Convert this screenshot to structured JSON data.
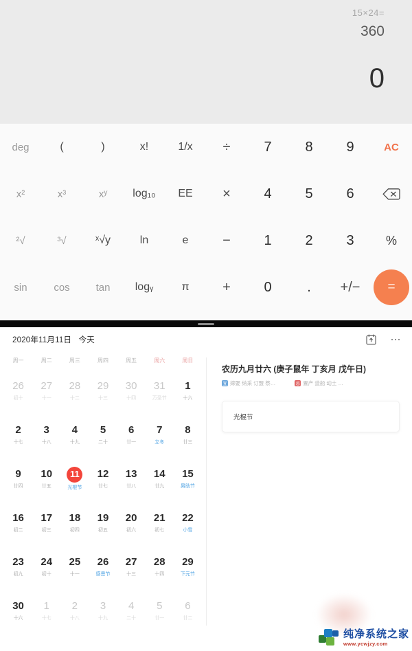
{
  "calculator": {
    "display": {
      "expression": "15×24=",
      "previous_result": "360",
      "current": "0"
    },
    "rows": [
      [
        {
          "label": "deg",
          "type": "fn",
          "name": "deg"
        },
        {
          "label": "(",
          "type": "fn-dark",
          "name": "open-paren"
        },
        {
          "label": ")",
          "type": "fn-dark",
          "name": "close-paren"
        },
        {
          "label": "x!",
          "type": "fn-dark",
          "name": "factorial"
        },
        {
          "label": "1/x",
          "type": "fn-dark",
          "name": "reciprocal"
        },
        {
          "label": "÷",
          "type": "op",
          "name": "divide"
        },
        {
          "label": "7",
          "type": "num",
          "name": "seven"
        },
        {
          "label": "8",
          "type": "num",
          "name": "eight"
        },
        {
          "label": "9",
          "type": "num",
          "name": "nine"
        },
        {
          "label": "AC",
          "type": "ac",
          "name": "all-clear"
        }
      ],
      [
        {
          "label": "x²",
          "type": "fn",
          "name": "square"
        },
        {
          "label": "x³",
          "type": "fn",
          "name": "cube"
        },
        {
          "label": "xʸ",
          "type": "fn",
          "name": "power"
        },
        {
          "label": "log₁₀",
          "type": "fn-dark",
          "name": "log10"
        },
        {
          "label": "EE",
          "type": "fn-dark",
          "name": "exponent"
        },
        {
          "label": "×",
          "type": "op",
          "name": "multiply"
        },
        {
          "label": "4",
          "type": "num",
          "name": "four"
        },
        {
          "label": "5",
          "type": "num",
          "name": "five"
        },
        {
          "label": "6",
          "type": "num",
          "name": "six"
        },
        {
          "label": "",
          "type": "backspace",
          "name": "backspace"
        }
      ],
      [
        {
          "label": "²√",
          "type": "fn",
          "name": "square-root"
        },
        {
          "label": "³√",
          "type": "fn",
          "name": "cube-root"
        },
        {
          "label": "ˣ√y",
          "type": "fn-dark",
          "name": "nth-root"
        },
        {
          "label": "ln",
          "type": "fn-dark",
          "name": "natural-log"
        },
        {
          "label": "e",
          "type": "fn-dark",
          "name": "euler-number"
        },
        {
          "label": "−",
          "type": "op",
          "name": "minus"
        },
        {
          "label": "1",
          "type": "num",
          "name": "one"
        },
        {
          "label": "2",
          "type": "num",
          "name": "two"
        },
        {
          "label": "3",
          "type": "num",
          "name": "three"
        },
        {
          "label": "%",
          "type": "pct",
          "name": "percent"
        }
      ],
      [
        {
          "label": "sin",
          "type": "fn",
          "name": "sine"
        },
        {
          "label": "cos",
          "type": "fn",
          "name": "cosine"
        },
        {
          "label": "tan",
          "type": "fn",
          "name": "tangent"
        },
        {
          "label": "logᵧ",
          "type": "fn-dark",
          "name": "log-base-y"
        },
        {
          "label": "π",
          "type": "fn-dark",
          "name": "pi"
        },
        {
          "label": "+",
          "type": "op",
          "name": "plus"
        },
        {
          "label": "0",
          "type": "num",
          "name": "zero"
        },
        {
          "label": ".",
          "type": "num",
          "name": "decimal-point"
        },
        {
          "label": "+/−",
          "type": "op",
          "name": "sign-toggle"
        },
        {
          "label": "=",
          "type": "equals",
          "name": "equals"
        }
      ]
    ],
    "accent_color": "#f5804f",
    "ac_color": "#f2724a"
  },
  "calendar": {
    "header": {
      "date_title": "2020年11月11日",
      "today_label": "今天",
      "today_icon": "calendar-today-icon",
      "more_icon": "more-options-icon"
    },
    "weekdays": [
      {
        "label": "周一",
        "weekend": false
      },
      {
        "label": "周二",
        "weekend": false
      },
      {
        "label": "周三",
        "weekend": false
      },
      {
        "label": "周四",
        "weekend": false
      },
      {
        "label": "周五",
        "weekend": false
      },
      {
        "label": "周六",
        "weekend": true
      },
      {
        "label": "周日",
        "weekend": true
      }
    ],
    "weeks": [
      [
        {
          "num": "26",
          "lunar": "初十",
          "out": true
        },
        {
          "num": "27",
          "lunar": "十一",
          "out": true
        },
        {
          "num": "28",
          "lunar": "十二",
          "out": true
        },
        {
          "num": "29",
          "lunar": "十三",
          "out": true
        },
        {
          "num": "30",
          "lunar": "十四",
          "out": true
        },
        {
          "num": "31",
          "lunar": "万圣节",
          "out": true
        },
        {
          "num": "1",
          "lunar": "十六",
          "out": false
        }
      ],
      [
        {
          "num": "2",
          "lunar": "十七",
          "out": false
        },
        {
          "num": "3",
          "lunar": "十八",
          "out": false
        },
        {
          "num": "4",
          "lunar": "十九",
          "out": false
        },
        {
          "num": "5",
          "lunar": "二十",
          "out": false
        },
        {
          "num": "6",
          "lunar": "廿一",
          "out": false
        },
        {
          "num": "7",
          "lunar": "立冬",
          "out": false,
          "blue": true
        },
        {
          "num": "8",
          "lunar": "廿三",
          "out": false
        }
      ],
      [
        {
          "num": "9",
          "lunar": "廿四",
          "out": false
        },
        {
          "num": "10",
          "lunar": "廿五",
          "out": false
        },
        {
          "num": "11",
          "lunar": "光棍节",
          "out": false,
          "today": true
        },
        {
          "num": "12",
          "lunar": "廿七",
          "out": false
        },
        {
          "num": "13",
          "lunar": "廿八",
          "out": false
        },
        {
          "num": "14",
          "lunar": "廿九",
          "out": false
        },
        {
          "num": "15",
          "lunar": "男助节",
          "out": false,
          "blue": true
        }
      ],
      [
        {
          "num": "16",
          "lunar": "初二",
          "out": false
        },
        {
          "num": "17",
          "lunar": "初三",
          "out": false
        },
        {
          "num": "18",
          "lunar": "初四",
          "out": false
        },
        {
          "num": "19",
          "lunar": "初五",
          "out": false
        },
        {
          "num": "20",
          "lunar": "初六",
          "out": false
        },
        {
          "num": "21",
          "lunar": "初七",
          "out": false
        },
        {
          "num": "22",
          "lunar": "小雪",
          "out": false,
          "blue": true
        }
      ],
      [
        {
          "num": "23",
          "lunar": "初九",
          "out": false
        },
        {
          "num": "24",
          "lunar": "初十",
          "out": false
        },
        {
          "num": "25",
          "lunar": "十一",
          "out": false
        },
        {
          "num": "26",
          "lunar": "感恩节",
          "out": false,
          "blue": true
        },
        {
          "num": "27",
          "lunar": "十三",
          "out": false
        },
        {
          "num": "28",
          "lunar": "十四",
          "out": false
        },
        {
          "num": "29",
          "lunar": "下元节",
          "out": false,
          "blue": true
        }
      ],
      [
        {
          "num": "30",
          "lunar": "十六",
          "out": false
        },
        {
          "num": "1",
          "lunar": "十七",
          "out": true
        },
        {
          "num": "2",
          "lunar": "十八",
          "out": true
        },
        {
          "num": "3",
          "lunar": "十九",
          "out": true
        },
        {
          "num": "4",
          "lunar": "二十",
          "out": true
        },
        {
          "num": "5",
          "lunar": "廿一",
          "out": true
        },
        {
          "num": "6",
          "lunar": "廿二",
          "out": true
        }
      ]
    ],
    "detail": {
      "lunar_title": "农历九月廿六 (庚子鼠年 丁亥月 戊午日)",
      "yi_tag": "宜",
      "yi_text": "嫁娶 纳采 订盟 祭…",
      "ji_tag": "忌",
      "ji_text": "置产 造船 动土 …",
      "event": "光棍节"
    },
    "today_color": "#f3453b",
    "festival_color": "#4fa3e3"
  },
  "watermark": {
    "name": "纯净系统之家",
    "url": "www.ycwjzy.com"
  }
}
